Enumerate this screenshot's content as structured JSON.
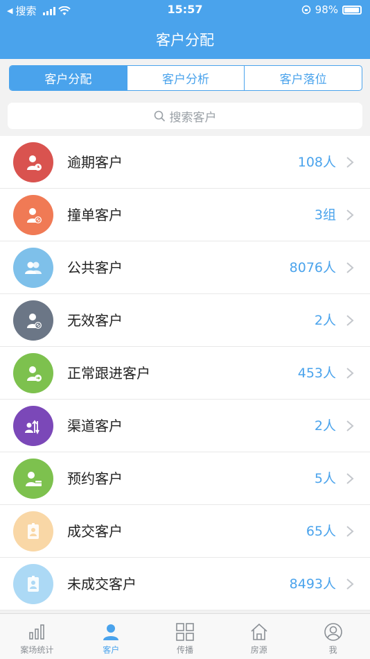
{
  "status_bar": {
    "back_app": "搜索",
    "time": "15:57",
    "battery": "98%"
  },
  "header": {
    "title": "客户分配"
  },
  "tabs": [
    {
      "label": "客户分配",
      "active": true
    },
    {
      "label": "客户分析",
      "active": false
    },
    {
      "label": "客户落位",
      "active": false
    }
  ],
  "search": {
    "placeholder": "搜索客户"
  },
  "rows": [
    {
      "label": "逾期客户",
      "count": "108人",
      "color": "#d9534f",
      "icon": "person-clock-icon"
    },
    {
      "label": "撞单客户",
      "count": "3组",
      "color": "#f07a55",
      "icon": "person-forbidden-icon"
    },
    {
      "label": "公共客户",
      "count": "8076人",
      "color": "#7ec0ea",
      "icon": "group-icon"
    },
    {
      "label": "无效客户",
      "count": "2人",
      "color": "#6b7686",
      "icon": "person-invalid-icon"
    },
    {
      "label": "正常跟进客户",
      "count": "453人",
      "color": "#7dc14e",
      "icon": "person-follow-icon"
    },
    {
      "label": "渠道客户",
      "count": "2人",
      "color": "#7b48b8",
      "icon": "person-channel-icon"
    },
    {
      "label": "预约客户",
      "count": "5人",
      "color": "#7dc14e",
      "icon": "person-calendar-icon"
    },
    {
      "label": "成交客户",
      "count": "65人",
      "color": "#f9d7a6",
      "icon": "badge-icon"
    },
    {
      "label": "未成交客户",
      "count": "8493人",
      "color": "#acd9f5",
      "icon": "badge-icon"
    }
  ],
  "tabbar": [
    {
      "label": "案场统计",
      "icon": "bar-chart-icon",
      "active": false
    },
    {
      "label": "客户",
      "icon": "person-icon",
      "active": true
    },
    {
      "label": "传播",
      "icon": "grid-icon",
      "active": false
    },
    {
      "label": "房源",
      "icon": "house-icon",
      "active": false
    },
    {
      "label": "我",
      "icon": "profile-icon",
      "active": false
    }
  ],
  "colors": {
    "accent": "#4aa3ec"
  }
}
